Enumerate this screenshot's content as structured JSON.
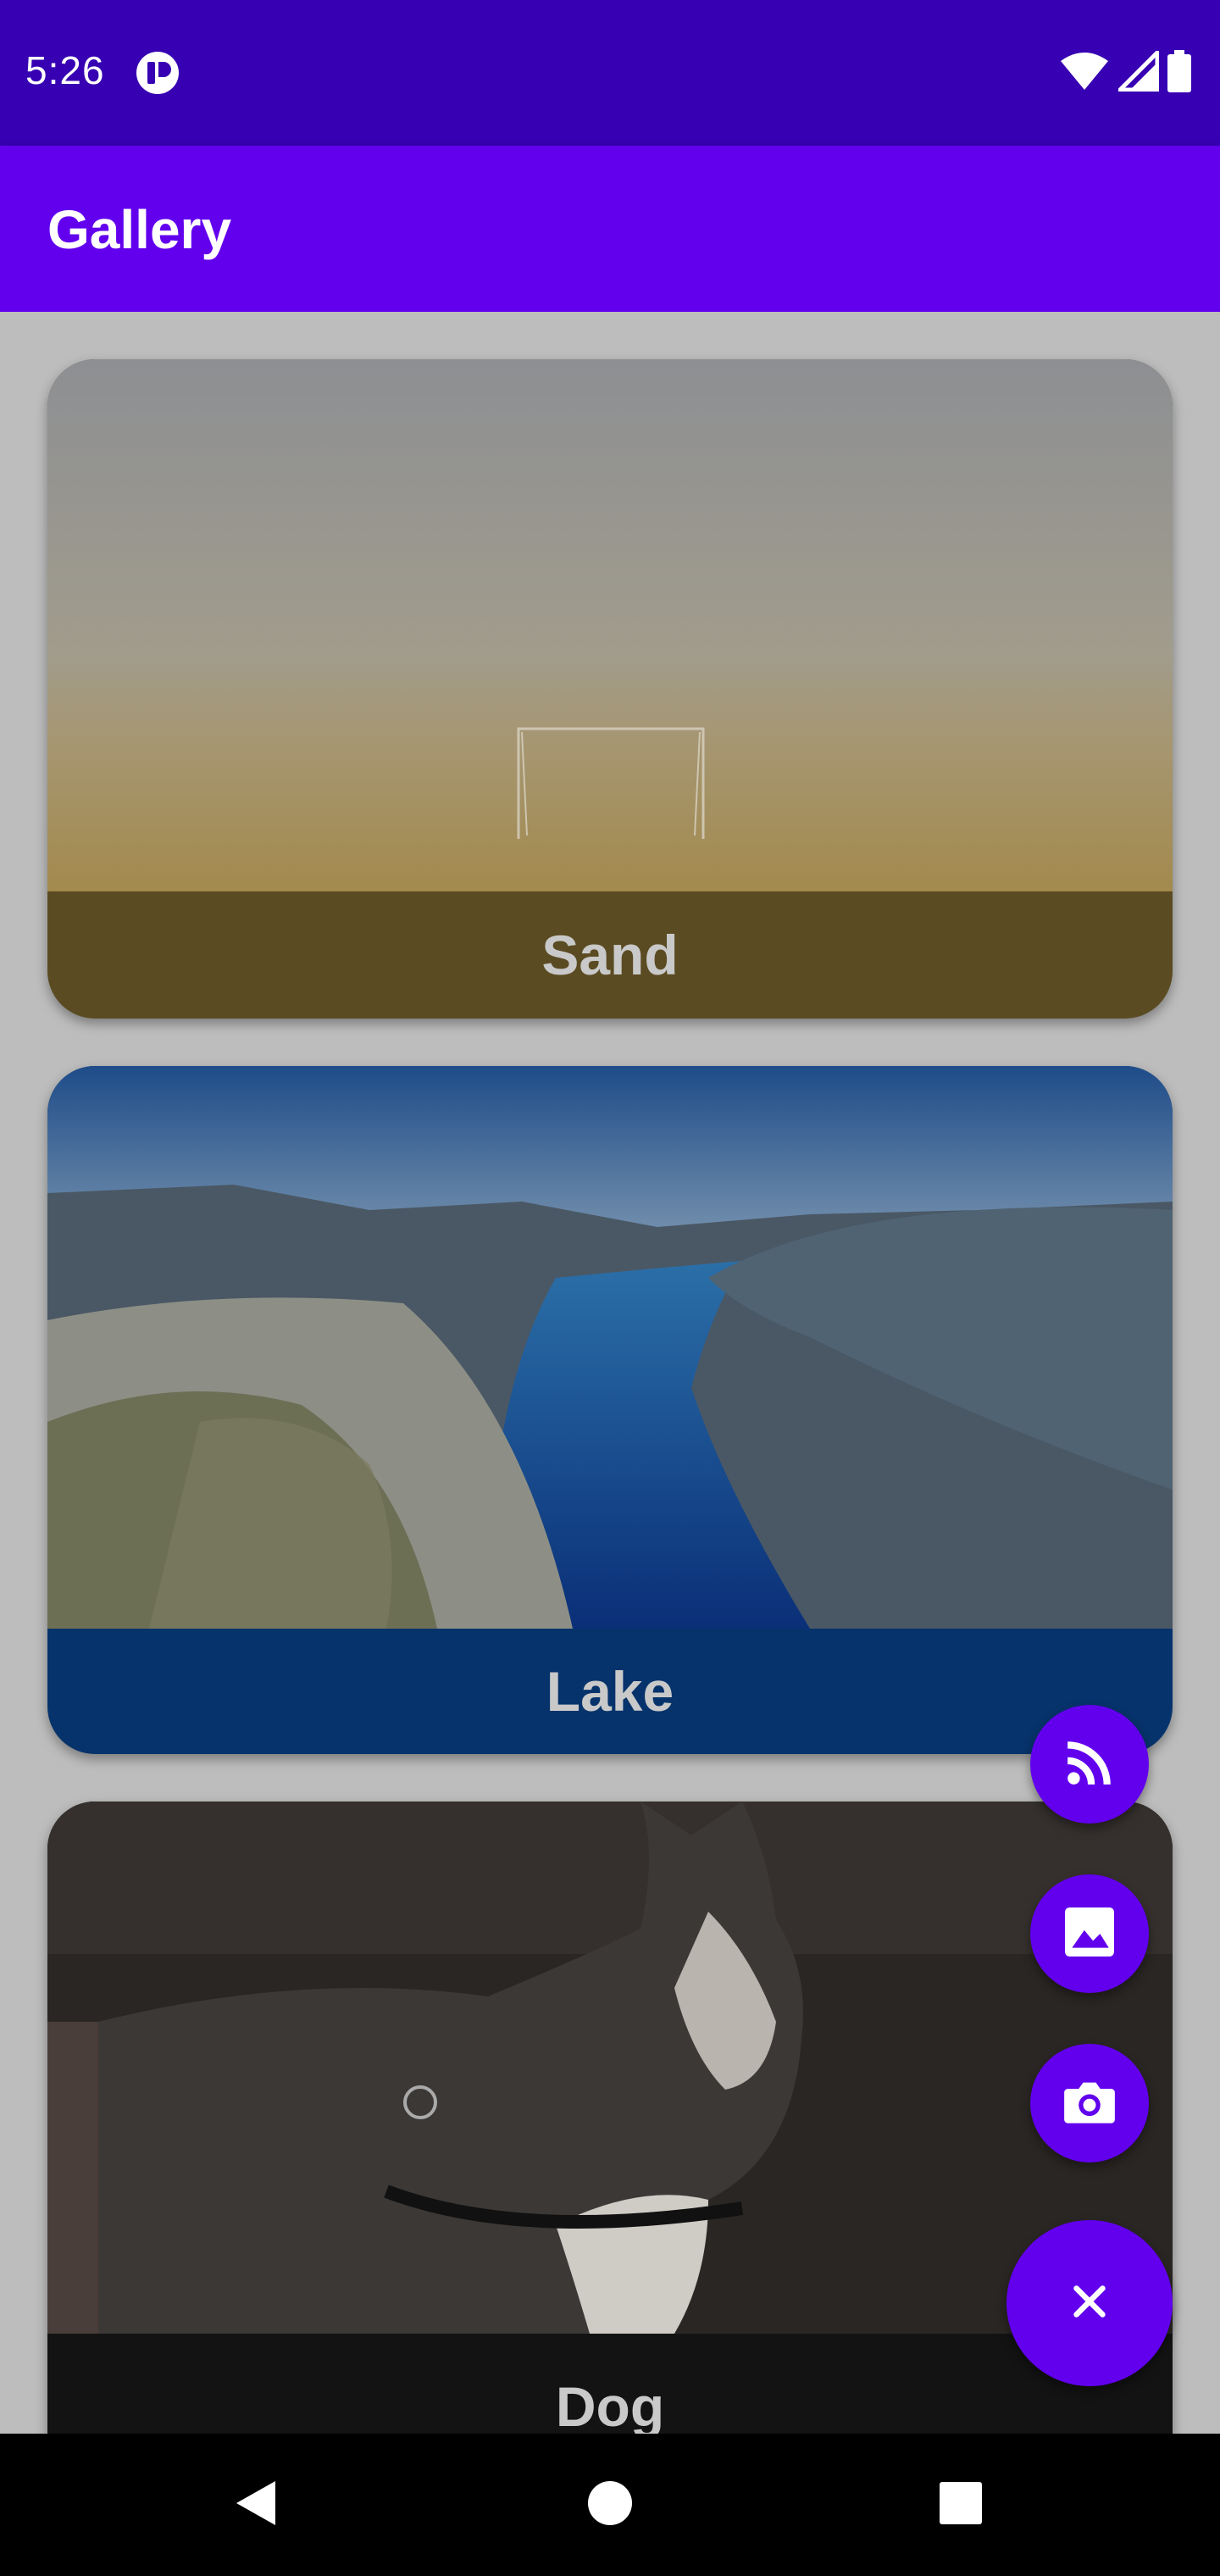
{
  "status_bar": {
    "time": "5:26",
    "icons": [
      "app-notification-icon",
      "wifi-icon",
      "cell-signal-icon",
      "battery-icon"
    ]
  },
  "app_bar": {
    "title": "Gallery"
  },
  "gallery": {
    "items": [
      {
        "label": "Sand",
        "caption_color": "#5b4b22",
        "image": "foggy-beach-goal-photo"
      },
      {
        "label": "Lake",
        "caption_color": "#06336b",
        "image": "fjord-lake-photo"
      },
      {
        "label": "Dog",
        "caption_color": "#131313",
        "image": "husky-dog-photo"
      }
    ]
  },
  "fab_menu": {
    "actions": [
      {
        "icon": "rss-feed-icon"
      },
      {
        "icon": "image-icon"
      },
      {
        "icon": "camera-icon"
      }
    ],
    "main_icon": "close-icon"
  },
  "colors": {
    "primary": "#6200ee",
    "primary_dark": "#3700b3"
  }
}
